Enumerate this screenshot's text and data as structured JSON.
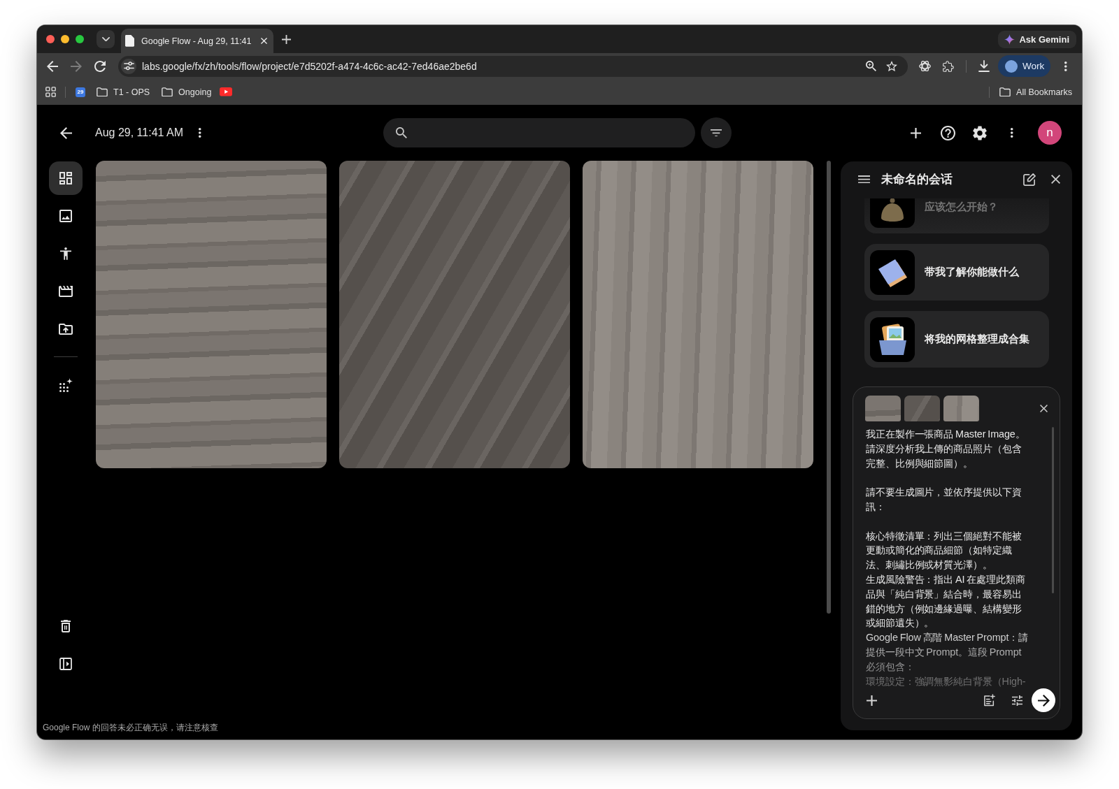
{
  "browser": {
    "tabs": [
      {
        "title": "Google Flow - Aug 29, 11:41",
        "selected": true
      }
    ],
    "ask_gemini": "Ask Gemini",
    "nav_buttons": [
      {
        "kind": "back",
        "disabled": false
      },
      {
        "kind": "forward",
        "disabled": true
      },
      {
        "kind": "reload",
        "disabled": false
      }
    ],
    "address_bar": {
      "value": "labs.google/fx/zh/tools/flow/project/e7d5202f-a474-4c6c-ac42-7ed46ae2be6d"
    },
    "profile": {
      "label": "Work"
    },
    "bookmarks": [
      {
        "kind": "apps"
      },
      {
        "kind": "calendar",
        "label": "29"
      },
      {
        "kind": "folder",
        "label": "T1 - OPS"
      },
      {
        "kind": "folder",
        "label": "Ongoing"
      },
      {
        "kind": "video"
      }
    ],
    "all_bookmarks": {
      "label": "All Bookmarks"
    }
  },
  "header": {
    "title": "Aug 29, 11:41 AM",
    "avatar": "n"
  },
  "sidebar": {
    "items": [
      {
        "kind": "grid",
        "selected": true
      },
      {
        "kind": "image",
        "selected": false
      },
      {
        "kind": "person",
        "selected": false
      },
      {
        "kind": "scenes",
        "selected": false
      },
      {
        "kind": "upload",
        "selected": false
      },
      {
        "kind": "divider"
      },
      {
        "kind": "sparkle",
        "selected": false
      }
    ],
    "bottom_actions": [
      {
        "kind": "trash"
      },
      {
        "kind": "panel"
      }
    ]
  },
  "gallery": {
    "items": [
      {
        "kind": "photo"
      },
      {
        "kind": "photo"
      },
      {
        "kind": "photo"
      }
    ]
  },
  "chat_panel": {
    "title": "未命名的会话",
    "suggestions": [
      {
        "kind": "bell",
        "text": "应该怎么开始？",
        "faded": true
      },
      {
        "kind": "book",
        "text": "带我了解你能做什么",
        "faded": false
      },
      {
        "kind": "folder",
        "text": "将我的网格整理成合集",
        "faded": false
      }
    ],
    "composer": {
      "attachments": [
        {
          "kind": "photo"
        },
        {
          "kind": "photo"
        },
        {
          "kind": "photo"
        }
      ],
      "paragraph_groups": [
        [
          "我正在製作一張商品 Master Image。請深度分析我上傳的商品照片（包含完整、比例與細節圖）。"
        ],
        [
          "請不要生成圖片，並依序提供以下資訊："
        ],
        [
          "核心特徵清單：列出三個絕對不能被更動或簡化的商品細節（如特定織法、刺繡比例或材質光澤）。",
          "生成風險警告：指出 AI 在處理此類商品與「純白背景」結合時，最容易出錯的地方（例如邊緣過曝、結構變形或細節遺失）。",
          "Google Flow 高階 Master Prompt：請提供一段中文 Prompt。這段 Prompt 必須包含：",
          "環境設定：強調無影純白背景（High-"
        ]
      ]
    }
  },
  "footer": {
    "disclaimer": "Google Flow 的回答未必正确无误，请注意核查"
  }
}
